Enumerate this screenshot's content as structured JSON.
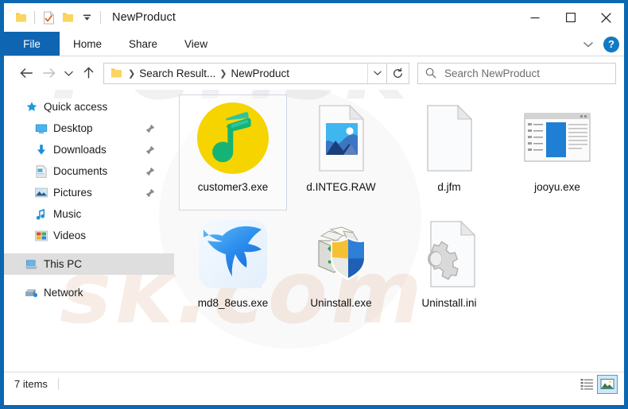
{
  "window": {
    "title": "NewProduct",
    "quick_access_icons": [
      "folder-icon",
      "properties-icon",
      "new-folder-icon",
      "customize-chevron-icon"
    ],
    "controls": {
      "minimize": "minimize-icon",
      "maximize": "maximize-icon",
      "close": "close-icon"
    },
    "border_color": "#0d66b0"
  },
  "ribbon": {
    "tabs": [
      {
        "label": "File",
        "active": true
      },
      {
        "label": "Home",
        "active": false
      },
      {
        "label": "Share",
        "active": false
      },
      {
        "label": "View",
        "active": false
      }
    ],
    "collapse_icon": "chevron-down-icon",
    "help_label": "?",
    "accent_color": "#0f65b2"
  },
  "navigation": {
    "back": "back-arrow-icon",
    "forward": "forward-arrow-icon",
    "recent": "recent-locations-chevron-icon",
    "up": "up-arrow-icon",
    "refresh": "refresh-icon",
    "breadcrumbs": [
      "Search Result...",
      "NewProduct"
    ],
    "dropdown": "chevron-down-icon"
  },
  "search": {
    "placeholder": "Search NewProduct",
    "icon": "search-icon"
  },
  "sidebar": {
    "items": [
      {
        "label": "Quick access",
        "icon": "star-icon",
        "indent": false,
        "pinned": false,
        "selected": false
      },
      {
        "label": "Desktop",
        "icon": "desktop-icon",
        "indent": true,
        "pinned": true,
        "selected": false
      },
      {
        "label": "Downloads",
        "icon": "downloads-icon",
        "indent": true,
        "pinned": true,
        "selected": false
      },
      {
        "label": "Documents",
        "icon": "documents-icon",
        "indent": true,
        "pinned": true,
        "selected": false
      },
      {
        "label": "Pictures",
        "icon": "pictures-icon",
        "indent": true,
        "pinned": true,
        "selected": false
      },
      {
        "label": "Music",
        "icon": "music-note-icon",
        "indent": true,
        "pinned": false,
        "selected": false
      },
      {
        "label": "Videos",
        "icon": "videos-icon",
        "indent": true,
        "pinned": false,
        "selected": false
      }
    ],
    "groups": [
      {
        "label": "This PC",
        "icon": "this-pc-icon",
        "selected": true
      },
      {
        "label": "Network",
        "icon": "network-icon",
        "selected": false
      }
    ]
  },
  "files": [
    {
      "name": "customer3.exe",
      "icon": "qq-music-note-icon",
      "selected": true
    },
    {
      "name": "d.INTEG.RAW",
      "icon": "image-file-icon",
      "selected": false
    },
    {
      "name": "d.jfm",
      "icon": "blank-file-icon",
      "selected": false
    },
    {
      "name": "jooyu.exe",
      "icon": "application-window-icon",
      "selected": false
    },
    {
      "name": "md8_8eus.exe",
      "icon": "blue-hummingbird-icon",
      "selected": false
    },
    {
      "name": "Uninstall.exe",
      "icon": "uninstall-shield-icon",
      "selected": false
    },
    {
      "name": "Uninstall.ini",
      "icon": "config-gear-file-icon",
      "selected": false
    }
  ],
  "status": {
    "item_count": "7 items",
    "views": [
      {
        "name": "details-view",
        "active": false
      },
      {
        "name": "large-icons-view",
        "active": true
      }
    ]
  },
  "watermark": {
    "line1": "PCrisk",
    "line2": "sk.com"
  }
}
